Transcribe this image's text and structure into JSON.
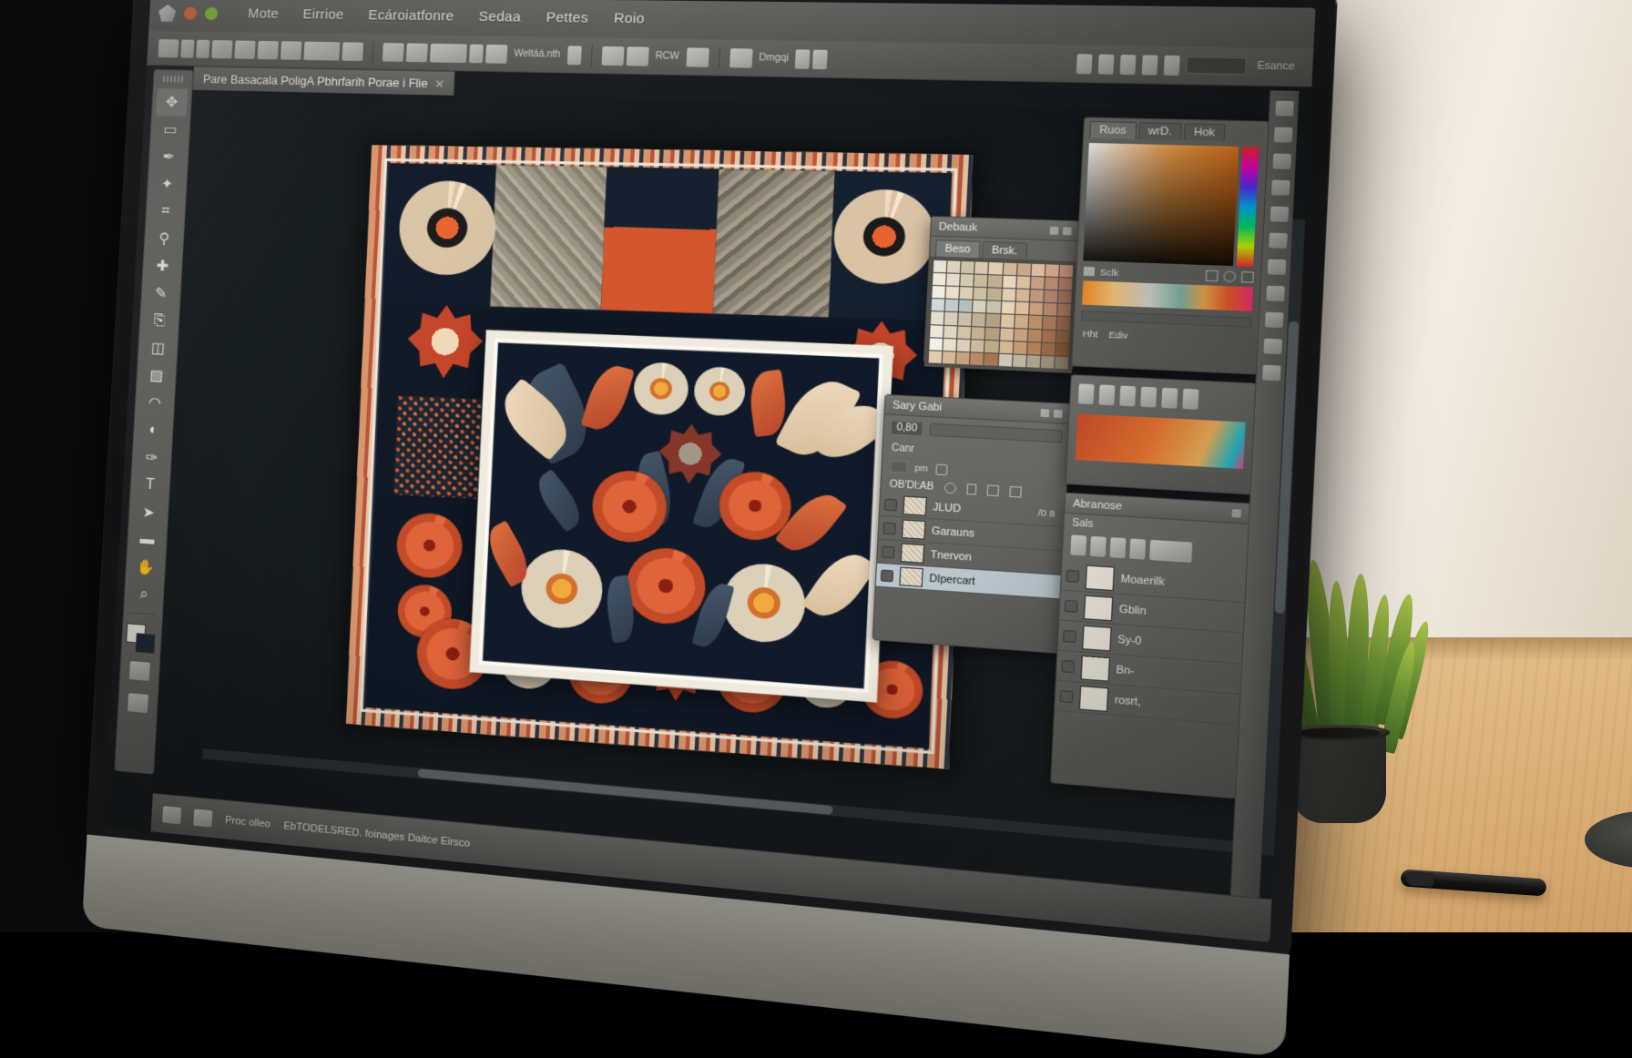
{
  "app": {
    "menus": [
      "Mote",
      "Eirrioe",
      "Ecároiatfonre",
      "Sedaa",
      "Pettes",
      "Roio"
    ],
    "logo_icon": "app-logo-icon",
    "window_dots": [
      "close-dot",
      "minimize-dot"
    ]
  },
  "options_bar": {
    "items": [
      "move-tool-icon",
      "lasso-icon",
      "crop-icon",
      "heal-icon",
      "brush-icon",
      "eraser-icon",
      "gradient-icon",
      "text-icon"
    ],
    "group2": [
      "align-left-icon",
      "align-center-icon",
      "distribute-icon",
      "link-icon",
      "mask-icon"
    ],
    "field_label": "Weltáá.nth",
    "right_items": [
      "grid-icon",
      "guides-icon",
      "rulers-icon",
      "snap-icon",
      "zoom-icon"
    ],
    "label_a": "RCW",
    "label_b": "Dmgqi",
    "workspace_label": "Esance"
  },
  "document_tab": {
    "title": "Pare Basacala PoligA Pbhrfarih Porae i Flie",
    "close_icon": "close-icon"
  },
  "tools": {
    "items": [
      {
        "name": "move-tool",
        "glyph": "✥"
      },
      {
        "name": "marquee-tool",
        "glyph": "▭"
      },
      {
        "name": "lasso-tool",
        "glyph": "✒"
      },
      {
        "name": "magic-wand-tool",
        "glyph": "✦"
      },
      {
        "name": "crop-tool",
        "glyph": "⌗"
      },
      {
        "name": "eyedropper-tool",
        "glyph": "⚲"
      },
      {
        "name": "healing-brush-tool",
        "glyph": "✚"
      },
      {
        "name": "brush-tool",
        "glyph": "✎"
      },
      {
        "name": "clone-stamp-tool",
        "glyph": "⎘"
      },
      {
        "name": "eraser-tool",
        "glyph": "◫"
      },
      {
        "name": "gradient-tool",
        "glyph": "▨"
      },
      {
        "name": "blur-tool",
        "glyph": "◠"
      },
      {
        "name": "dodge-tool",
        "glyph": "◐"
      },
      {
        "name": "pen-tool",
        "glyph": "✑"
      },
      {
        "name": "type-tool",
        "glyph": "T"
      },
      {
        "name": "path-select-tool",
        "glyph": "➤"
      },
      {
        "name": "shape-tool",
        "glyph": "▬"
      },
      {
        "name": "hand-tool",
        "glyph": "✋"
      },
      {
        "name": "zoom-tool",
        "glyph": "⌕"
      }
    ],
    "foreground_color": "#e9e6dd",
    "background_color": "#1d2633"
  },
  "swatches_panel": {
    "title": "Debauk",
    "tabs": [
      {
        "label": "Beso",
        "active": true
      },
      {
        "label": "Brsk.",
        "active": false
      }
    ],
    "buttons": [
      "panel-menu-icon",
      "panel-close-icon"
    ],
    "colors": [
      "#e8e2d4",
      "#dcd2be",
      "#cfc2a8",
      "#d8c8ae",
      "#e0ccb2",
      "#d6b79a",
      "#cfa98a",
      "#e3c0a5",
      "#d8a98c",
      "#c4907a",
      "#efe8da",
      "#e6dcc9",
      "#d4c9b2",
      "#c9bba0",
      "#bfae93",
      "#e9d6bb",
      "#dcc2a2",
      "#caa184",
      "#bb8d72",
      "#aa7a63",
      "#f0ece2",
      "#ece0cc",
      "#ddd0b6",
      "#cdbfa4",
      "#c0ae92",
      "#e2cdb0",
      "#d5b694",
      "#c49a7c",
      "#b1856c",
      "#9d7259",
      "#cfd9d8",
      "#c2ccca",
      "#b5bfbd",
      "#d9d1bf",
      "#ccc2ab",
      "#e8d4b6",
      "#dcbf9c",
      "#cb9f7f",
      "#b6886c",
      "#a37358",
      "#e4ddce",
      "#d8cfba",
      "#cbbfa6",
      "#bfb094",
      "#b3a183",
      "#dcc3a4",
      "#cfac87",
      "#bd8e6b",
      "#a87857",
      "#946548",
      "#efe6d7",
      "#e2d6c2",
      "#d3c4a9",
      "#c4b193",
      "#b69f7e",
      "#d8bb98",
      "#c9a07a",
      "#b5855f",
      "#a06e4c",
      "#8c5c3c",
      "#f3efe6",
      "#e8dfd0",
      "#dbcfb9",
      "#ccbc9f",
      "#bdaa89",
      "#d5b794",
      "#c59a73",
      "#b07e57",
      "#9a6744",
      "#855534",
      "#e2ccb0",
      "#d5b896",
      "#c7a27d",
      "#b88a66",
      "#a87451",
      "#d0c7bb",
      "#bfb3a4",
      "#ada08d",
      "#9b8c77",
      "#897a63"
    ]
  },
  "color_panel": {
    "tabs": [
      "Ruos",
      "wrD.",
      "Hok"
    ],
    "field_icon": "color-field",
    "hue_icon": "hue-strip",
    "bottom_labels": [
      "Sclk",
      "Hht",
      "Ediv"
    ],
    "toolbuttons": [
      "pick-icon",
      "add-icon",
      "sample-icon"
    ],
    "gradient_label": "gradient-preview"
  },
  "layers_panel": {
    "title": "Sary Gabi",
    "blend_mode": "0,80",
    "opacity_label": "Canr",
    "lock_label": "OB'Dl:AB",
    "lock_icons": [
      "lock-transparent-icon",
      "lock-pixels-icon",
      "lock-position-icon",
      "lock-all-icon"
    ],
    "rows": [
      {
        "name": "JLUD",
        "meta": "/0 8",
        "selected": false,
        "thumb": "layer-thumb"
      },
      {
        "name": "Garauns",
        "meta": "",
        "selected": false,
        "thumb": "layer-thumb"
      },
      {
        "name": "Tnervon",
        "meta": "",
        "selected": false,
        "thumb": "layer-thumb"
      },
      {
        "name": "DIpercart",
        "meta": "",
        "selected": true,
        "thumb": "layer-thumb"
      }
    ],
    "footer_icons": [
      "link-layers-icon",
      "layer-style-icon",
      "add-mask-icon",
      "new-group-icon",
      "new-layer-icon",
      "delete-layer-icon"
    ]
  },
  "right_layers_panel": {
    "title": "Abranose",
    "subtitle": "Sals",
    "rows": [
      {
        "name": "Moaerilk",
        "selected": false
      },
      {
        "name": "Gblin",
        "selected": false
      },
      {
        "name": "Sy-0",
        "selected": false
      },
      {
        "name": "Bn-",
        "selected": false
      },
      {
        "name": "rosrt,",
        "selected": false
      }
    ]
  },
  "status_bar": {
    "zoom_or_doc": "Proc olleo",
    "message": "EbTODELSRED. foinages Daitce Eirsco",
    "icons": [
      "document-info-icon",
      "new-document-icon"
    ]
  },
  "artwork": {
    "name": "folk-floral-textile-design",
    "background_color": "#111a2a",
    "accent_color": "#d4562c",
    "cream_color": "#f0e0c6",
    "border_color": "#e3b089",
    "leaf_color": "#3e4f60"
  },
  "desk_scene": {
    "plant": "potted-plant",
    "pen": "stylus-pen",
    "coaster": "desk-coaster",
    "desk_color": "#e0b87e",
    "wall_color": "#ece4d8"
  }
}
